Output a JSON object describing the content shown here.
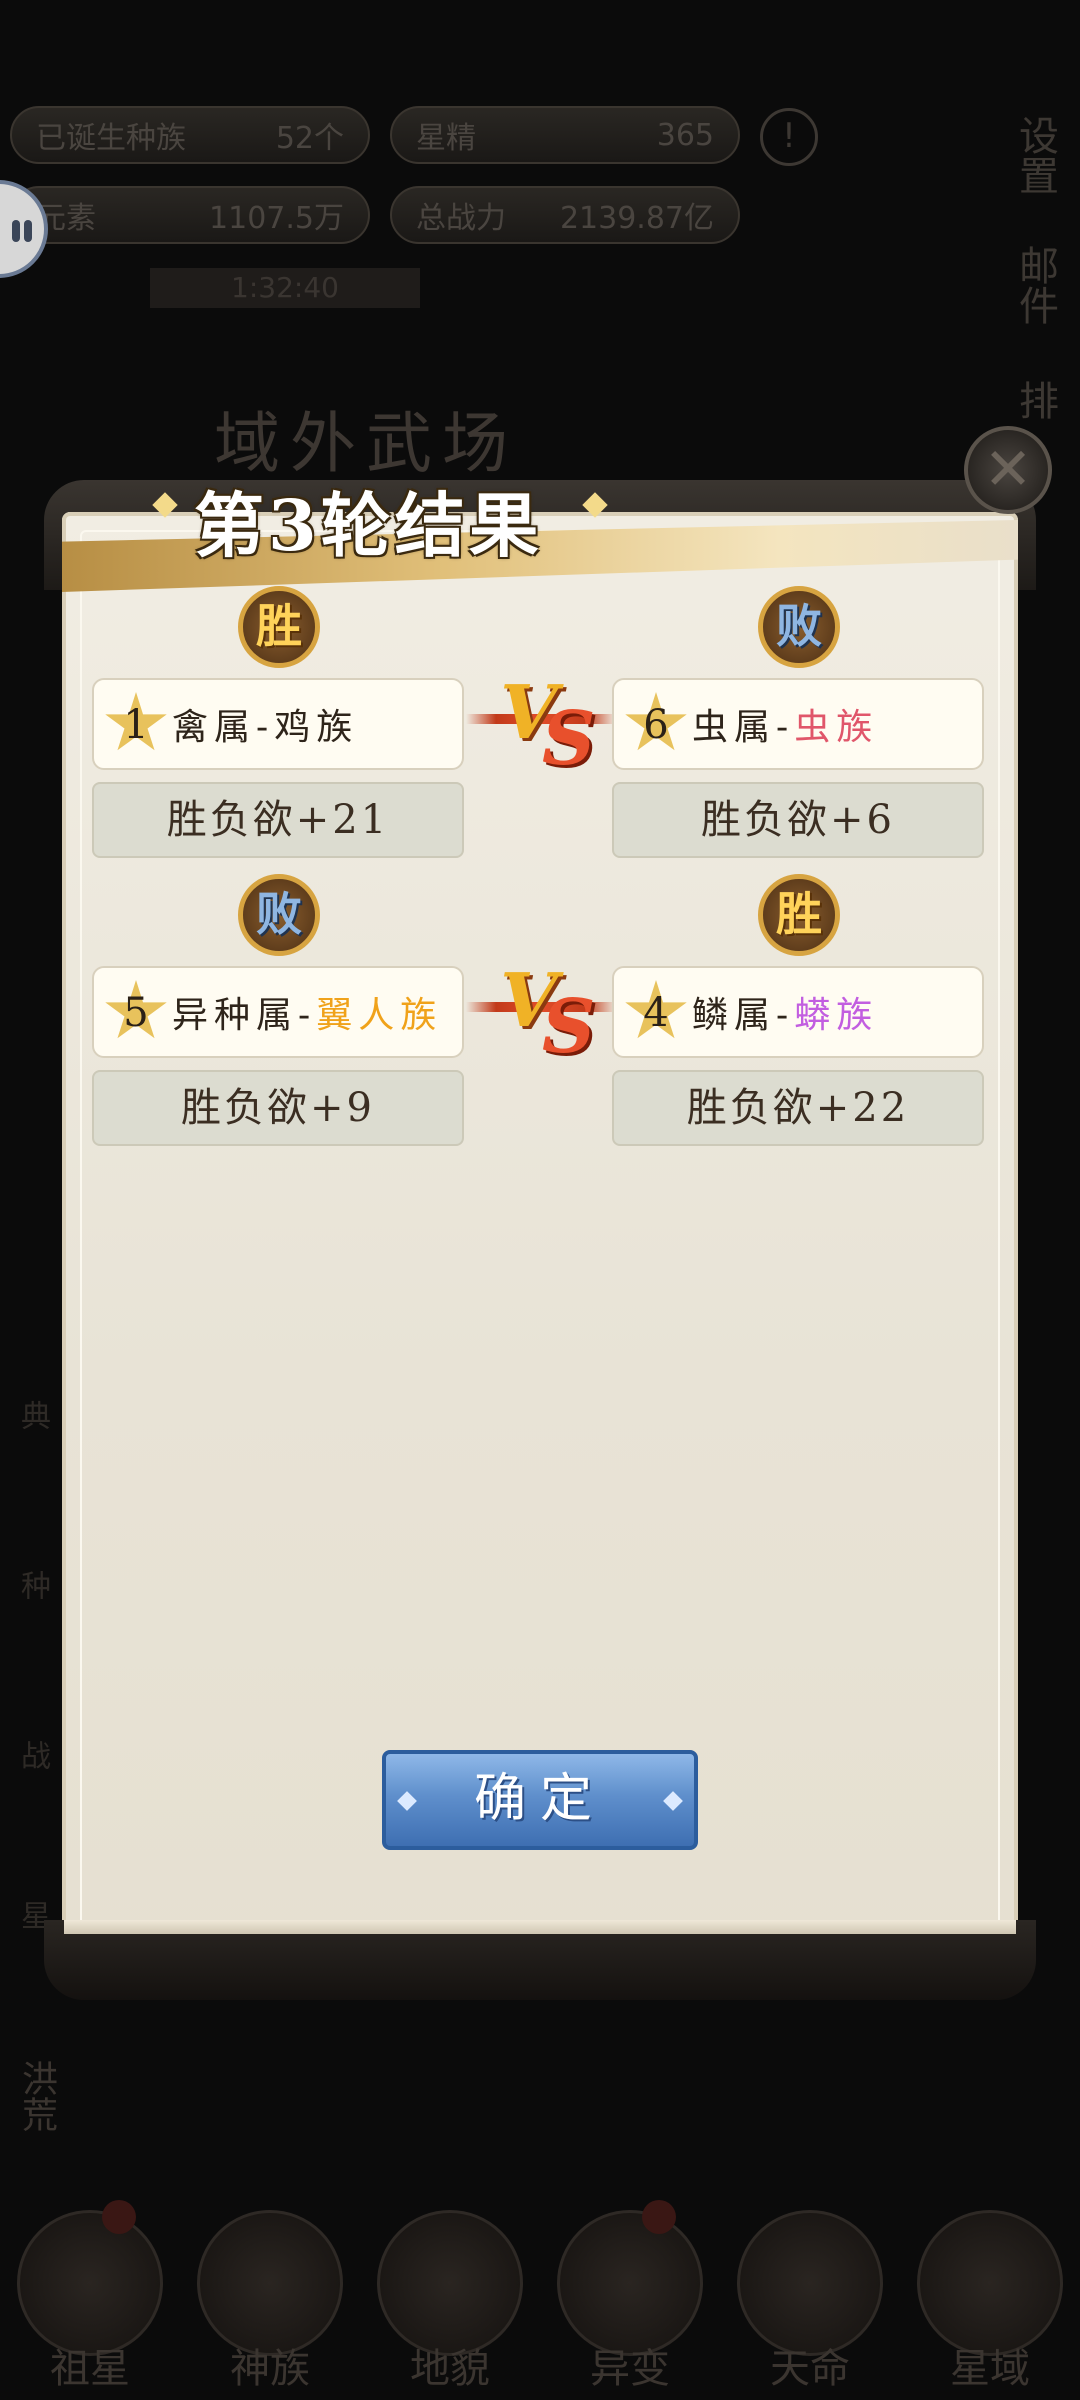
{
  "background": {
    "hud": [
      {
        "label": "已诞生种族",
        "value": "52个"
      },
      {
        "label": "星精",
        "value": "365"
      },
      {
        "label": "元素",
        "value": "1107.5万"
      },
      {
        "label": "总战力",
        "value": "2139.87亿"
      }
    ],
    "timer": "1:32:40",
    "side_buttons": [
      "设置",
      "邮件",
      "排"
    ],
    "left_tabs": [
      "典",
      "种",
      "战",
      "星"
    ],
    "event_label": "洪荒",
    "arena_title": "域外武场",
    "nav": [
      {
        "label": "祖星"
      },
      {
        "label": "神族"
      },
      {
        "label": "地貌"
      },
      {
        "label": "异变"
      },
      {
        "label": "天命"
      },
      {
        "label": "星域"
      }
    ]
  },
  "dialog": {
    "title": "第3轮结果",
    "close_symbol": "✕",
    "matches": [
      {
        "left": {
          "result": "胜",
          "seed": "1",
          "category": "禽属",
          "race": "鸡族",
          "race_color": "#2e241a",
          "stat": "胜负欲+21"
        },
        "right": {
          "result": "败",
          "seed": "6",
          "category": "虫属",
          "race": "虫族",
          "race_color": "#e0566a",
          "stat": "胜负欲+6"
        }
      },
      {
        "left": {
          "result": "败",
          "seed": "5",
          "category": "异种属",
          "race": "翼人族",
          "race_color": "#f0a21a",
          "stat": "胜负欲+9"
        },
        "right": {
          "result": "胜",
          "seed": "4",
          "category": "鳞属",
          "race": "蟒族",
          "race_color": "#c25ee0",
          "stat": "胜负欲+22"
        }
      }
    ],
    "vs_v": "V",
    "vs_s": "S",
    "confirm_label": "确定"
  }
}
